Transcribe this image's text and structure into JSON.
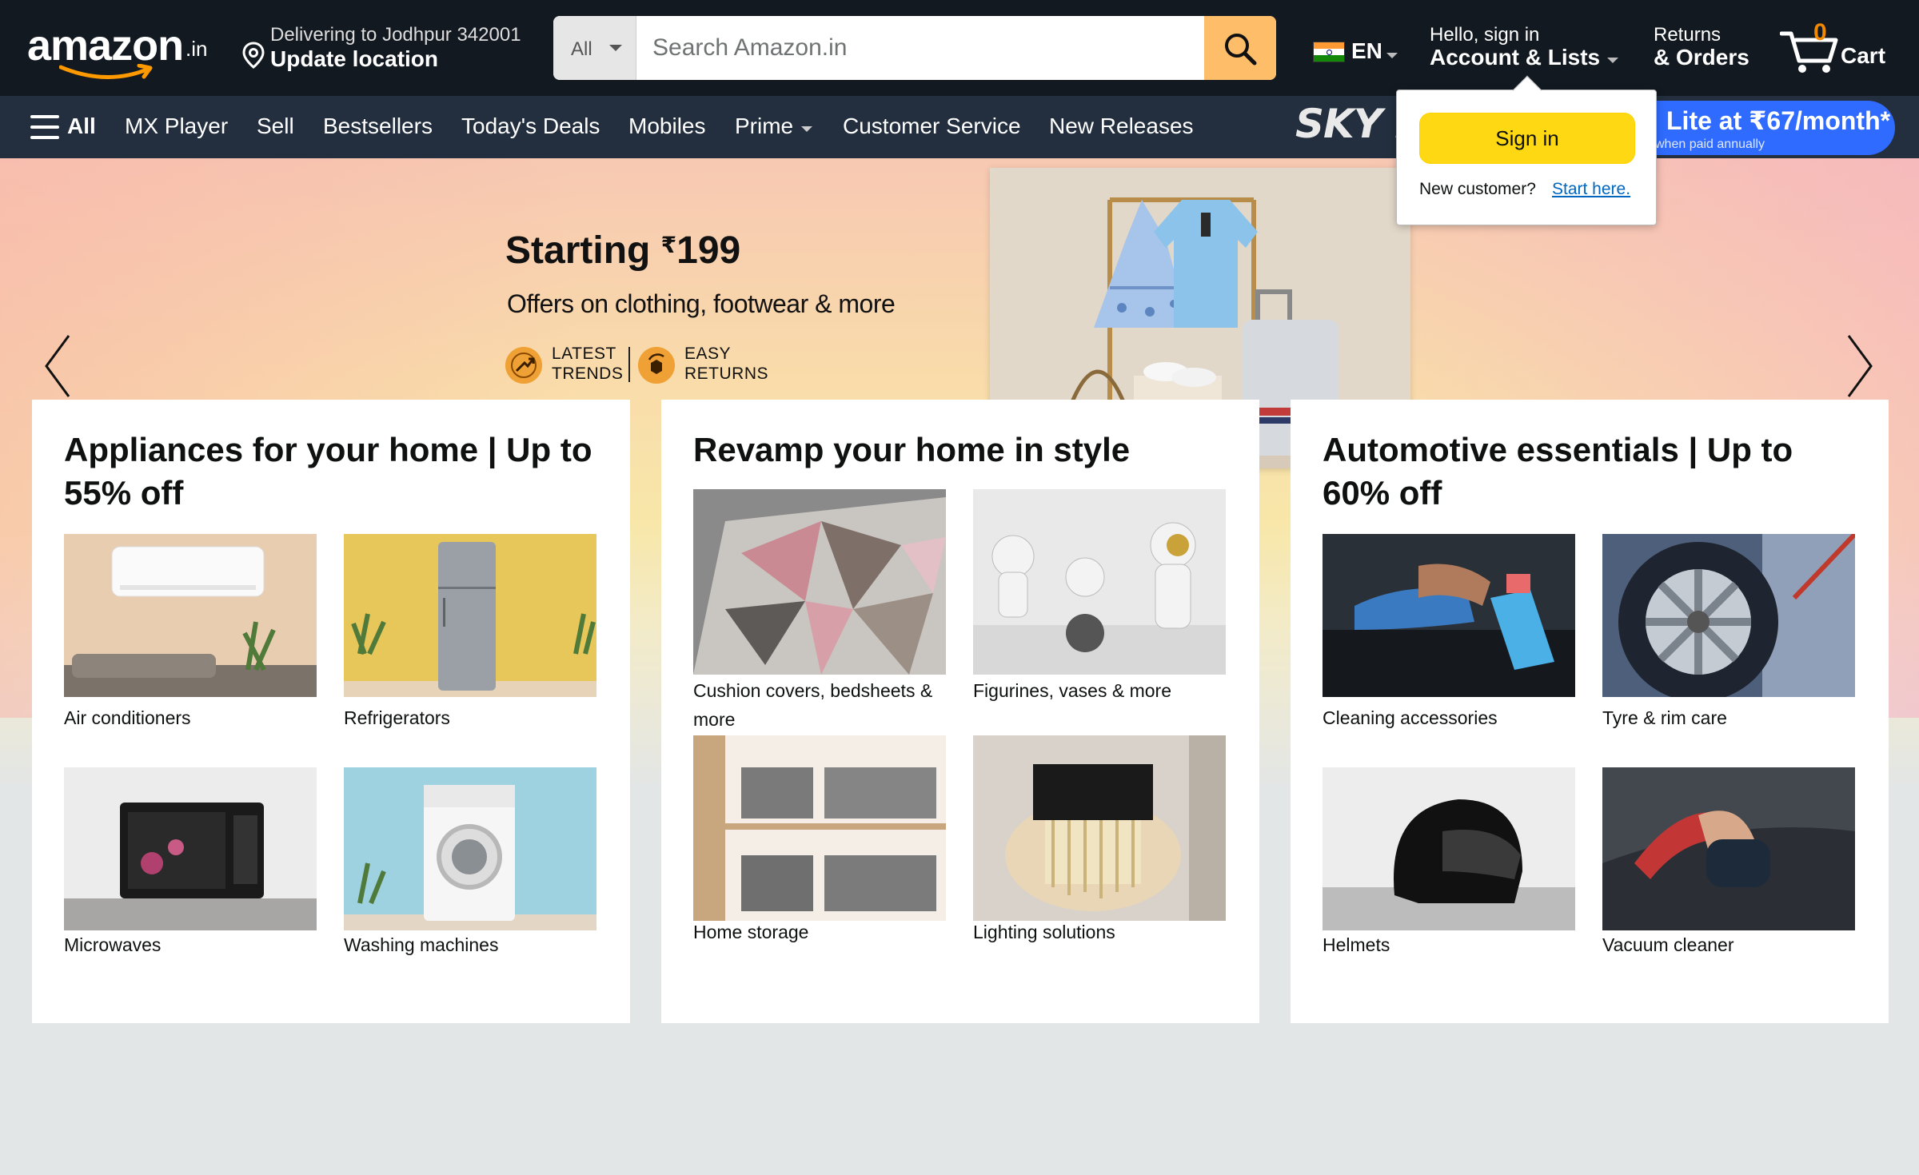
{
  "header": {
    "logo_text": "amazon",
    "logo_suffix": ".in",
    "deliver_line1": "Delivering to Jodhpur 342001",
    "deliver_line2": "Update location",
    "search_category": "All",
    "search_placeholder": "Search Amazon.in",
    "language": "EN",
    "account_line1": "Hello, sign in",
    "account_line2": "Account & Lists",
    "orders_line1": "Returns",
    "orders_line2": "& Orders",
    "cart_count": "0",
    "cart_label": "Cart"
  },
  "subnav": {
    "all": "All",
    "items": [
      "MX Player",
      "Sell",
      "Bestsellers",
      "Today's Deals",
      "Mobiles",
      "Prime",
      "Customer Service",
      "New Releases"
    ],
    "promo_sky": "SKY F",
    "promo_lite_big": "Lite at ₹67/month*",
    "promo_lite_small": "when paid annually"
  },
  "hero": {
    "title_prefix": "Starting ",
    "title_currency": "₹",
    "title_amount": "199",
    "subtitle": "Offers on clothing, footwear & more",
    "badge1_line1": "LATEST",
    "badge1_line2": "TRENDS",
    "badge2_line1": "EASY",
    "badge2_line2": "RETURNS"
  },
  "cards": [
    {
      "title": "Appliances for your home | Up to 55% off",
      "tiles": [
        "Air conditioners",
        "Refrigerators",
        "Microwaves",
        "Washing machines"
      ]
    },
    {
      "title": "Revamp your home in style",
      "tiles": [
        "Cushion covers, bedsheets & more",
        "Figurines, vases & more",
        "Home storage",
        "Lighting solutions"
      ]
    },
    {
      "title": "Automotive essentials | Up to 60% off",
      "tiles": [
        "Cleaning accessories",
        "Tyre & rim care",
        "Helmets",
        "Vacuum cleaner"
      ]
    }
  ],
  "flyout": {
    "signin_label": "Sign in",
    "new_customer": "New customer?",
    "start_here": "Start here."
  },
  "colors": {
    "nav_bg": "#131921",
    "subnav_bg": "#232f3e",
    "search_button": "#febd69",
    "cart_count": "#f08804",
    "signin_button": "#ffd814",
    "link": "#0066c0"
  }
}
